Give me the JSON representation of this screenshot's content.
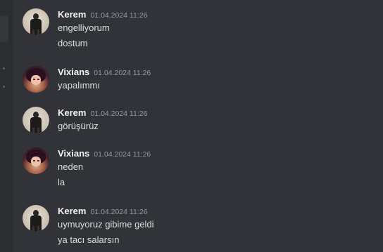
{
  "colors": {
    "background": "#313338",
    "sidebar": "#2b2d31",
    "username": "#f2f3f5",
    "timestamp": "#949ba4",
    "message_text": "#dbdee1"
  },
  "messages": [
    {
      "author": "Kerem",
      "avatar": "kerem-avatar",
      "timestamp": "01.04.2024 11:26",
      "lines": [
        "engelliyorum",
        "dostum"
      ]
    },
    {
      "author": "Vixians",
      "avatar": "vixians-avatar",
      "timestamp": "01.04.2024 11:26",
      "lines": [
        "yapalımmı"
      ]
    },
    {
      "author": "Kerem",
      "avatar": "kerem-avatar",
      "timestamp": "01.04.2024 11:26",
      "lines": [
        "görüşürüz"
      ]
    },
    {
      "author": "Vixians",
      "avatar": "vixians-avatar",
      "timestamp": "01.04.2024 11:26",
      "lines": [
        "neden",
        "la"
      ]
    },
    {
      "author": "Kerem",
      "avatar": "kerem-avatar",
      "timestamp": "01.04.2024 11:26",
      "lines": [
        "uymuyoruz gibime geldi",
        "ya tacı salarsın"
      ]
    }
  ]
}
